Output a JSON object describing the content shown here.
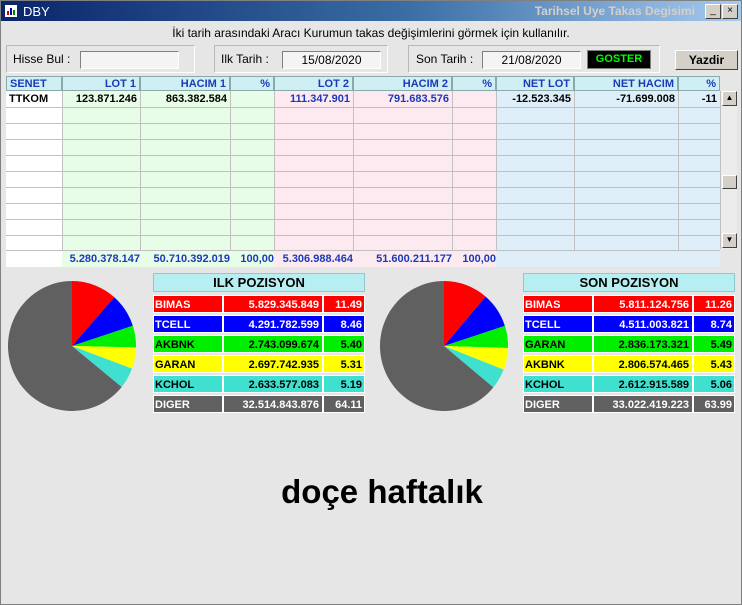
{
  "titlebar": {
    "app_name": "DBY",
    "window_title": "Tarihsel Uye Takas Degisimi",
    "min_label": "_",
    "max_label": "□",
    "close_label": "×"
  },
  "info_text": "İki tarih arasındaki  Aracı Kurumun takas değişimlerini görmek için kullanılır.",
  "filter": {
    "hisse_label": "Hisse Bul :",
    "hisse_value": "",
    "ilk_label": "Ilk Tarih :",
    "ilk_value": "15/08/2020",
    "son_label": "Son Tarih :",
    "son_value": "21/08/2020",
    "goster_label": "GOSTER",
    "yazdir_label": "Yazdir"
  },
  "table": {
    "headers": [
      "SENET",
      "LOT 1",
      "HACIM 1",
      "%",
      "LOT 2",
      "HACIM 2",
      "%",
      "NET LOT",
      "NET HACIM",
      "%"
    ],
    "rows": [
      [
        "TTKOM",
        "123.871.246",
        "863.382.584",
        "",
        "111.347.901",
        "791.683.576",
        "",
        "-12.523.345",
        "-71.699.008",
        "-11"
      ]
    ],
    "totals": [
      "",
      "5.280.378.147",
      "50.710.392.019",
      "100,00",
      "5.306.988.464",
      "51.600.211.177",
      "100,00",
      "",
      "",
      ""
    ]
  },
  "colors": {
    "bimas": "#ff0000",
    "tcell": "#0000ff",
    "akbnk": "#00ee00",
    "garan": "#ffff00",
    "kchol": "#40e0d0",
    "diger": "#606060"
  },
  "ilk_pozisyon": {
    "title": "ILK POZISYON",
    "rows": [
      {
        "name": "BIMAS",
        "value": "5.829.345.849",
        "pct": "11.49",
        "pct_num": 11.49,
        "color": "#ff0000",
        "text": "#ffffff"
      },
      {
        "name": "TCELL",
        "value": "4.291.782.599",
        "pct": "8.46",
        "pct_num": 8.46,
        "color": "#0000ff",
        "text": "#ffffff"
      },
      {
        "name": "AKBNK",
        "value": "2.743.099.674",
        "pct": "5.40",
        "pct_num": 5.4,
        "color": "#00ee00",
        "text": "#000000"
      },
      {
        "name": "GARAN",
        "value": "2.697.742.935",
        "pct": "5.31",
        "pct_num": 5.31,
        "color": "#ffff00",
        "text": "#000000"
      },
      {
        "name": "KCHOL",
        "value": "2.633.577.083",
        "pct": "5.19",
        "pct_num": 5.19,
        "color": "#40e0d0",
        "text": "#000000"
      },
      {
        "name": "DIGER",
        "value": "32.514.843.876",
        "pct": "64.11",
        "pct_num": 64.11,
        "color": "#606060",
        "text": "#ffffff"
      }
    ]
  },
  "son_pozisyon": {
    "title": "SON POZISYON",
    "rows": [
      {
        "name": "BIMAS",
        "value": "5.811.124.756",
        "pct": "11.26",
        "pct_num": 11.26,
        "color": "#ff0000",
        "text": "#ffffff"
      },
      {
        "name": "TCELL",
        "value": "4.511.003.821",
        "pct": "8.74",
        "pct_num": 8.74,
        "color": "#0000ff",
        "text": "#ffffff"
      },
      {
        "name": "GARAN",
        "value": "2.836.173.321",
        "pct": "5.49",
        "pct_num": 5.49,
        "color": "#00ee00",
        "text": "#000000"
      },
      {
        "name": "AKBNK",
        "value": "2.806.574.465",
        "pct": "5.43",
        "pct_num": 5.43,
        "color": "#ffff00",
        "text": "#000000"
      },
      {
        "name": "KCHOL",
        "value": "2.612.915.589",
        "pct": "5.06",
        "pct_num": 5.06,
        "color": "#40e0d0",
        "text": "#000000"
      },
      {
        "name": "DIGER",
        "value": "33.022.419.223",
        "pct": "63.99",
        "pct_num": 63.99,
        "color": "#606060",
        "text": "#ffffff"
      }
    ]
  },
  "caption": "doçe haftalık"
}
